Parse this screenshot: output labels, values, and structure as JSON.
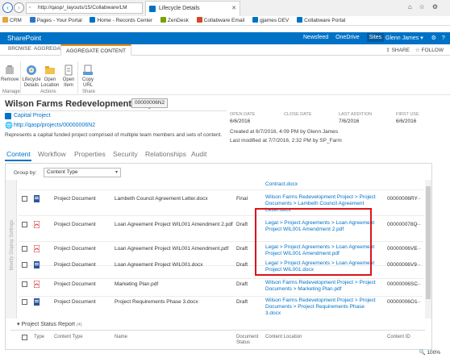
{
  "browser": {
    "url": "http://qasp/_layouts/15/Collabware/LM",
    "tab_title": "Lifecycle Details",
    "favorites": [
      "CRM",
      "Pages - Your Portal",
      "Home - Records Center",
      "ZenDesk",
      "Collabware Email",
      "gjames DEV",
      "Collabware Portal"
    ],
    "zoom": "100%"
  },
  "suite": {
    "brand": "SharePoint",
    "links": [
      "Newsfeed",
      "OneDrive",
      "Sites"
    ],
    "user": "Glenn James"
  },
  "ribbon": {
    "tabs": [
      "BROWSE",
      "AGGREGATE",
      "AGGREGATE CONTENT"
    ],
    "share": "SHARE",
    "follow": "FOLLOW",
    "buttons": {
      "remove": "Remove",
      "lifecycle_details": "Lifecycle Details",
      "open_location": "Open Location",
      "open_item": "Open Item",
      "copy_url": "Copy URL"
    },
    "groups": [
      "Manage",
      "Actions",
      "Share"
    ]
  },
  "header": {
    "title": "Wilson Farms Redevelopment Project",
    "project_id": "00000006N2",
    "type": "Capital Project",
    "url": "http://qasp/projects/00000006N2",
    "description": "Represents a capital funded project comprised of multiple team members and sets of content.",
    "open_date_label": "OPEN DATE",
    "open_date": "6/6/2016",
    "close_date_label": "CLOSE DATE",
    "last_addition_label": "LAST ADDITION",
    "last_addition": "7/6/2016",
    "first_use_label": "FIRST USE",
    "first_use": "6/6/2016",
    "created": "Created at 6/7/2016, 4:09 PM by Glenn James",
    "modified": "Last modified at 7/7/2016, 2:32 PM by SP_Farm"
  },
  "page_tabs": [
    "Content",
    "Workflow",
    "Properties",
    "Security",
    "Relationships",
    "Audit"
  ],
  "content": {
    "group_by_label": "Group by:",
    "group_by_value": "Content Type",
    "side_label": "Modify Display Settings",
    "partial_location": "Contract.docx",
    "rows": [
      {
        "type": "Project Document",
        "name": "Lambeth Council Agreement Letter.docx",
        "status": "Final",
        "location": "Wilson Farms Redevelopment Project > Project Documents > Lambeth Council Agreement Letter.docx",
        "id": "00000006RY"
      },
      {
        "type": "Project Document",
        "name": "Loan Agreement Project WIL001 Amendment 2.pdf",
        "status": "Draft",
        "location": "Legal > Project Agreements > Loan Agreement Project WIL001 Amendment 2.pdf",
        "id": "000000078Q"
      },
      {
        "type": "Project Document",
        "name": "Loan Agreement Project WIL001 Amendment.pdf",
        "status": "Draft",
        "location": "Legal > Project Agreements > Loan Agreement Project WIL001 Amendment.pdf",
        "id": "00000006VE"
      },
      {
        "type": "Project Document",
        "name": "Loan Agreement Project WIL001.docx",
        "status": "Draft",
        "location": "Legal > Project Agreements > Loan Agreement Project WIL001.docx",
        "id": "00000006V9"
      },
      {
        "type": "Project Document",
        "name": "Marketing Plan.pdf",
        "status": "Draft",
        "location": "Wilson Farms Redevelopment Project > Project Documents > Marketing Plan.pdf",
        "id": "00000006SC"
      },
      {
        "type": "Project Document",
        "name": "Project Requirements Phase 3.docx",
        "status": "Draft",
        "location": "Wilson Farms Redevelopment Project > Project Documents > Project Requirements Phase 3.docx",
        "id": "00000006O1"
      }
    ],
    "more_glyph": "...",
    "group2_title": "Project Status Report",
    "group2_count": "(4)",
    "columns": [
      "Type",
      "Content Type",
      "Name",
      "Document Status",
      "Content Location",
      "Content ID"
    ]
  },
  "colors": {
    "accent": "#0072c6",
    "ribbon_active": "#ff8c00",
    "highlight": "#d9141b"
  }
}
